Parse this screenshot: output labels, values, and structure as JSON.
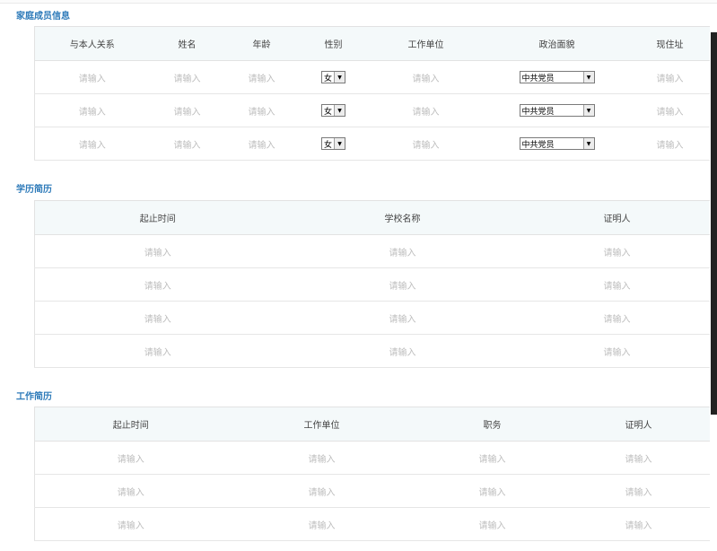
{
  "family": {
    "title": "家庭成员信息",
    "columns": [
      "与本人关系",
      "姓名",
      "年龄",
      "性别",
      "工作单位",
      "政治面貌",
      "现住址"
    ],
    "placeholder": "请输入",
    "rows": [
      {
        "gender": "女",
        "political": "中共党员"
      },
      {
        "gender": "女",
        "political": "中共党员"
      },
      {
        "gender": "女",
        "political": "中共党员"
      }
    ]
  },
  "education": {
    "title": "学历简历",
    "columns": [
      "起止时间",
      "学校名称",
      "证明人"
    ],
    "placeholder": "请输入",
    "row_count": 4
  },
  "work": {
    "title": "工作简历",
    "columns": [
      "起止时间",
      "工作单位",
      "职务",
      "证明人"
    ],
    "placeholder": "请输入",
    "row_count": 3
  },
  "icons": {
    "dropdown": "triangle-down-icon"
  }
}
